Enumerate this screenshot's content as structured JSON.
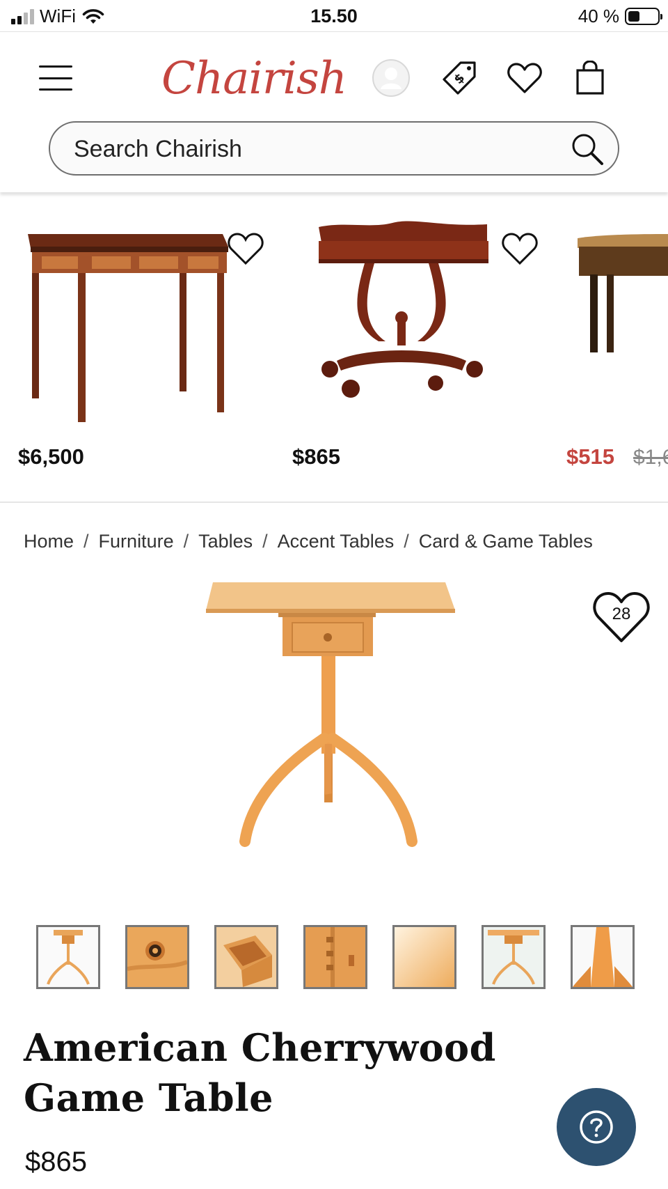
{
  "status_bar": {
    "carrier": "WiFi",
    "time": "15.50",
    "battery": "40 %",
    "battery_level": 0.4
  },
  "header": {
    "logo": "Chairish",
    "search_placeholder": "Search Chairish"
  },
  "carousel": [
    {
      "price": "$6,500"
    },
    {
      "price": "$865"
    },
    {
      "price": "$515",
      "old_price": "$1,6",
      "on_sale": true
    }
  ],
  "breadcrumb": [
    "Home",
    "Furniture",
    "Tables",
    "Accent Tables",
    "Card & Game Tables"
  ],
  "product": {
    "like_count": "28",
    "title": "American Cherrywood Game Table",
    "price": "$865",
    "thumbnail_count": 7
  },
  "colors": {
    "brand": "#c4453f",
    "help_button": "#2d5170",
    "wood_light": "#e9a55a"
  }
}
